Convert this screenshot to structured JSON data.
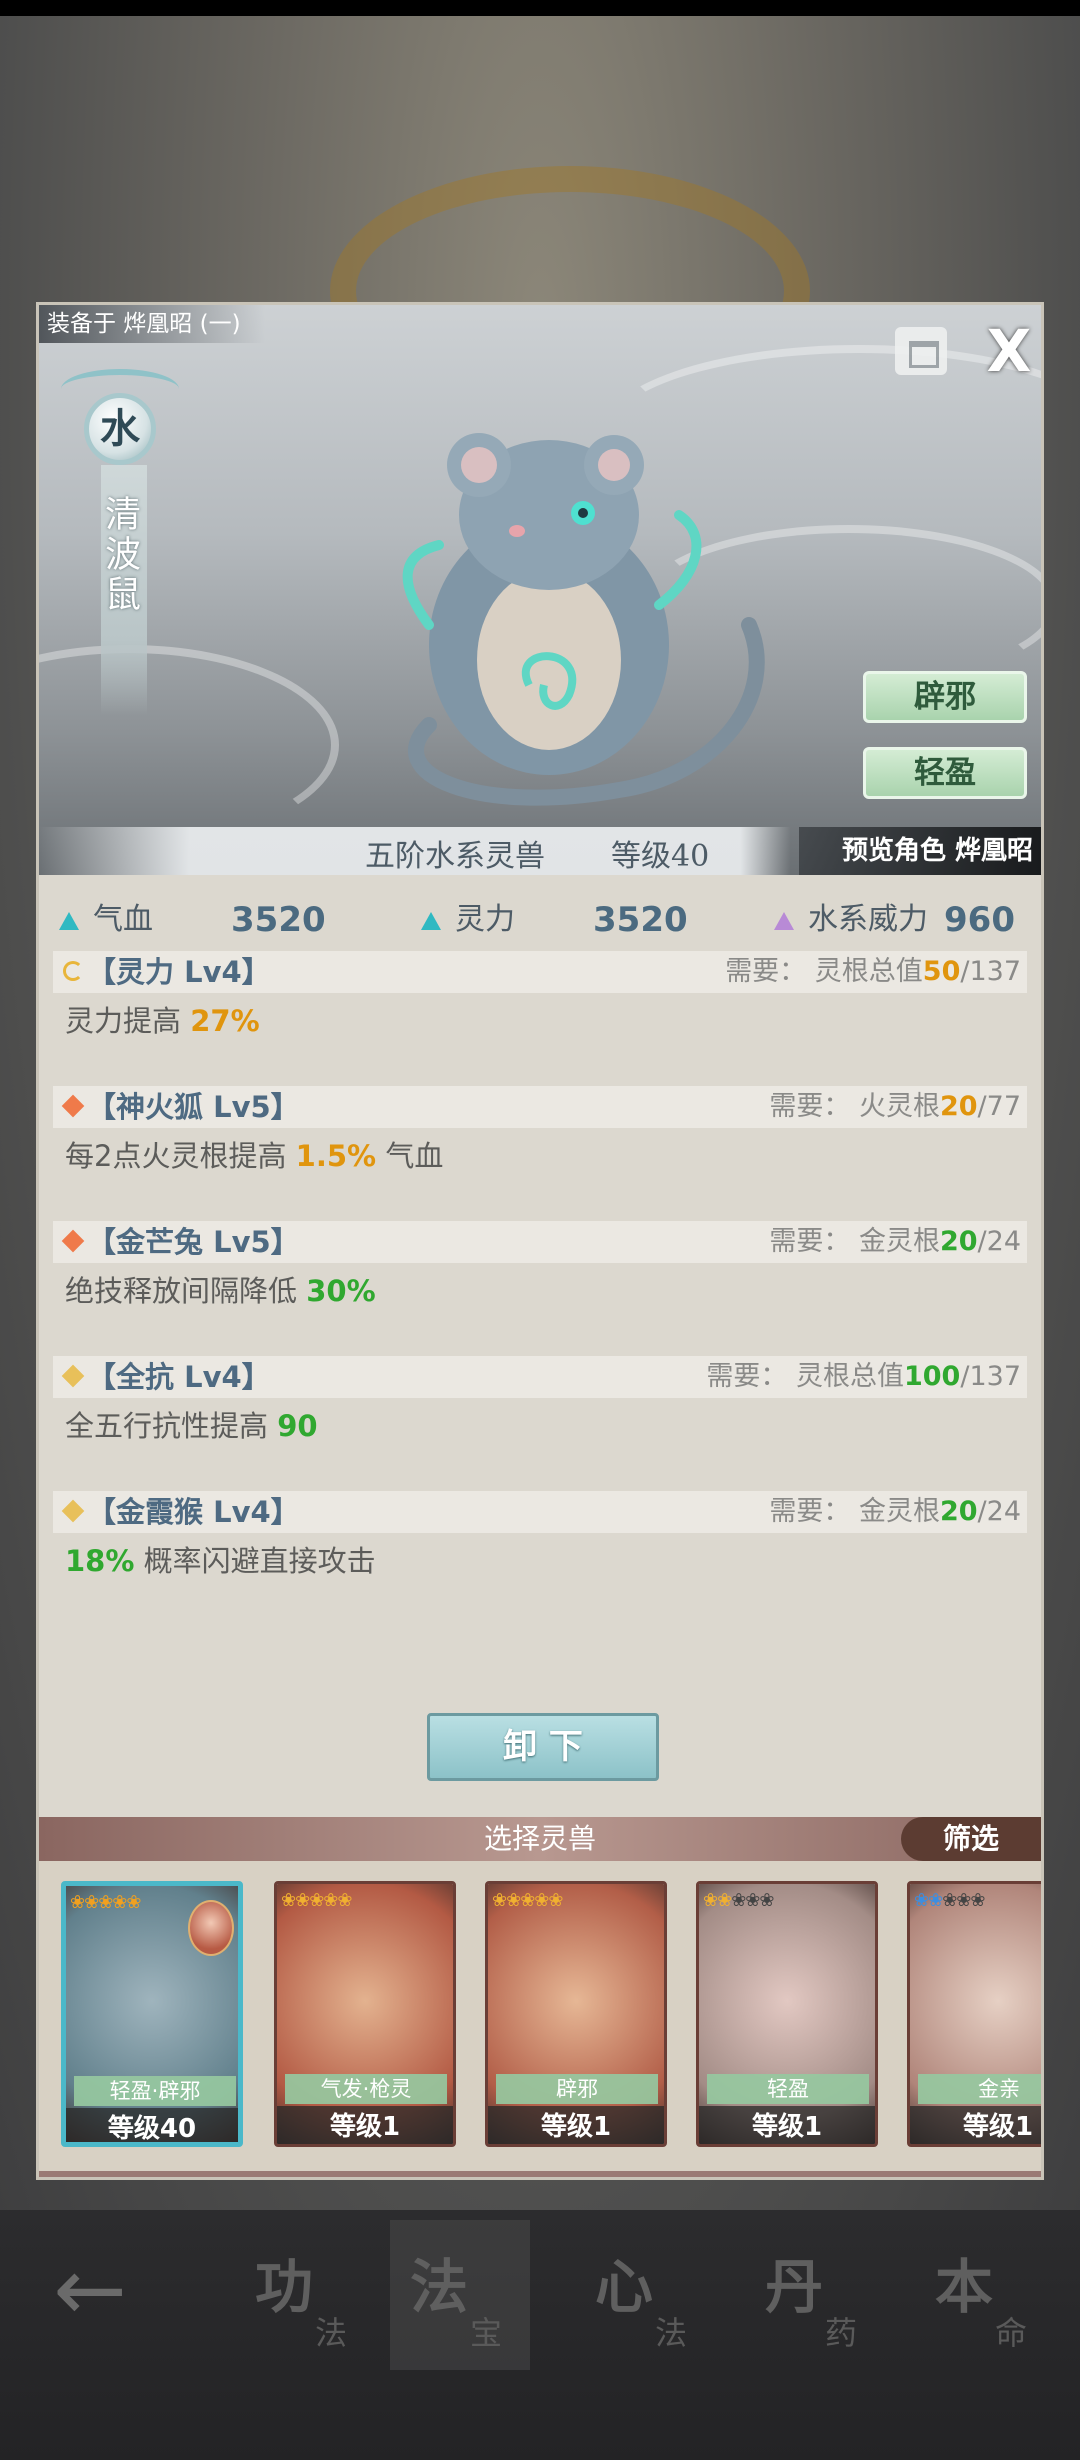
{
  "header": {
    "equipped_label": "装备于 烨凰昭 (一)"
  },
  "beast": {
    "element": "水",
    "name": "清波鼠",
    "grade": "五阶水系灵兽",
    "level": "等级40",
    "preview_role": "预览角色 烨凰昭",
    "skill_buttons": [
      "辟邪",
      "轻盈"
    ]
  },
  "stats": [
    {
      "label": "气血",
      "value": "3520",
      "color": "#2fb9c2"
    },
    {
      "label": "灵力",
      "value": "3520",
      "color": "#2fb9c2"
    },
    {
      "label": "水系威力",
      "value": "960",
      "color": "#b88ad6"
    }
  ],
  "passives": [
    {
      "icon": "refresh-icon",
      "title": "【灵力 Lv4】",
      "req_label": "需要： 灵根总值",
      "req_current": "50",
      "req_total": "/137",
      "req_color": "orange",
      "desc_pre": "灵力提高 ",
      "desc_value": "27%",
      "desc_post": "",
      "value_color": "orange"
    },
    {
      "icon": "orange-diamond-icon",
      "title": "【神火狐 Lv5】",
      "req_label": "需要： 火灵根",
      "req_current": "20",
      "req_total": "/77",
      "req_color": "orange",
      "desc_pre": "每2点火灵根提高 ",
      "desc_value": "1.5%",
      "desc_post": " 气血",
      "value_color": "orange"
    },
    {
      "icon": "orange-diamond-icon",
      "title": "【金芒兔 Lv5】",
      "req_label": "需要： 金灵根",
      "req_current": "20",
      "req_total": "/24",
      "req_color": "green",
      "desc_pre": "绝技释放间隔降低 ",
      "desc_value": "30%",
      "desc_post": "",
      "value_color": "green"
    },
    {
      "icon": "yellow-diamond-icon",
      "title": "【全抗 Lv4】",
      "req_label": "需要： 灵根总值",
      "req_current": "100",
      "req_total": "/137",
      "req_color": "green",
      "desc_pre": "全五行抗性提高 ",
      "desc_value": "90",
      "desc_post": "",
      "value_color": "green"
    },
    {
      "icon": "yellow-diamond-icon",
      "title": "【金霞猴 Lv4】",
      "req_label": "需要： 金灵根",
      "req_current": "20",
      "req_total": "/24",
      "req_color": "green",
      "desc_pre": "",
      "desc_value": "18%",
      "desc_post": " 概率闪避直接攻击",
      "value_color": "green"
    }
  ],
  "unequip_label": "卸 下",
  "select_label": "选择灵兽",
  "filter_label": "筛选",
  "pets": [
    {
      "stars_on": 5,
      "stars_off": 0,
      "star_color": "#f0a020",
      "skills": "轻盈·辟邪",
      "level": "等级40",
      "selected": true,
      "palette": [
        "#9fb4bd",
        "#61808c"
      ],
      "has_avatar": true
    },
    {
      "stars_on": 5,
      "stars_off": 0,
      "star_color": "#f0b030",
      "skills": "气发·枪灵",
      "level": "等级1",
      "selected": false,
      "palette": [
        "#e3b28f",
        "#b35a44"
      ],
      "has_avatar": false
    },
    {
      "stars_on": 5,
      "stars_off": 0,
      "star_color": "#f0b030",
      "skills": "辟邪",
      "level": "等级1",
      "selected": false,
      "palette": [
        "#e6b795",
        "#b25e48"
      ],
      "has_avatar": false
    },
    {
      "stars_on": 2,
      "stars_off": 3,
      "star_color": "#f0b030",
      "skills": "轻盈",
      "level": "等级1",
      "selected": false,
      "palette": [
        "#e2c8c2",
        "#a38c86"
      ],
      "has_avatar": false
    },
    {
      "stars_on": 2,
      "stars_off": 3,
      "star_color": "#3c8ee0",
      "skills": "金亲",
      "level": "等级1",
      "selected": false,
      "palette": [
        "#e6d0c4",
        "#b0857a"
      ],
      "has_avatar": false
    }
  ],
  "bottom_nav": [
    {
      "big": "功",
      "small": "法"
    },
    {
      "big": "法",
      "small": "宝"
    },
    {
      "big": "心",
      "small": "法"
    },
    {
      "big": "丹",
      "small": "药"
    },
    {
      "big": "本",
      "small": "命"
    }
  ]
}
